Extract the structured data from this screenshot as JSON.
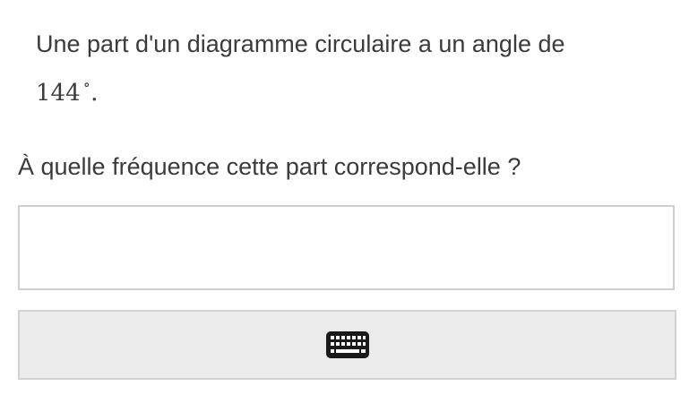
{
  "statement": {
    "text": "Une part d'un diagramme circulaire a un angle de",
    "angle_value": "144",
    "degree_symbol": "∘",
    "period": "."
  },
  "question": {
    "text": "À quelle fréquence cette part correspond-elle ?"
  },
  "answer": {
    "value": "",
    "placeholder": ""
  },
  "keyboard_button": {
    "icon": "keyboard-icon"
  }
}
